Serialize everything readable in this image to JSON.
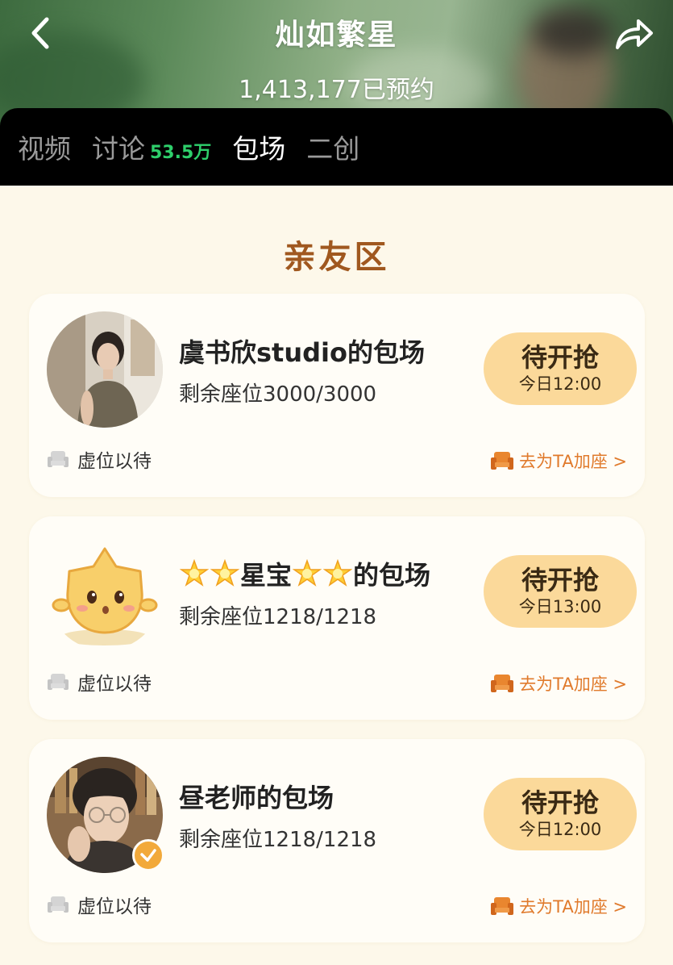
{
  "header": {
    "title": "灿如繁星",
    "reserve_count": "1,413,177已预约",
    "back_icon": "chevron-left-icon",
    "share_icon": "share-arrow-icon"
  },
  "tabs": [
    {
      "label": "视频",
      "count": ""
    },
    {
      "label": "讨论",
      "count": "53.5万"
    },
    {
      "label": "包场",
      "count": ""
    },
    {
      "label": "二创",
      "count": ""
    }
  ],
  "active_tab": "包场",
  "section": {
    "title": "亲友区"
  },
  "cards": [
    {
      "name": "虞书欣studio的包场",
      "seats": "剩余座位3000/3000",
      "button_label": "待开抢",
      "button_time": "今日12:00",
      "wait_label": "虚位以待",
      "add_seat_label": "去为TA加座 >"
    },
    {
      "name_middle": "星宝",
      "name_suffix": "的包场",
      "seats": "剩余座位1218/1218",
      "button_label": "待开抢",
      "button_time": "今日13:00",
      "wait_label": "虚位以待",
      "add_seat_label": "去为TA加座 >"
    },
    {
      "name": "昼老师的包场",
      "seats": "剩余座位1218/1218",
      "button_label": "待开抢",
      "button_time": "今日12:00",
      "wait_label": "虚位以待",
      "add_seat_label": "去为TA加座 >"
    }
  ],
  "colors": {
    "accent_orange": "#e07a2c",
    "section_title": "#a0581f",
    "button_bg": "#fbd99a",
    "tab_count_green": "#2ecf6b",
    "page_bg": "#fdf8ea"
  }
}
